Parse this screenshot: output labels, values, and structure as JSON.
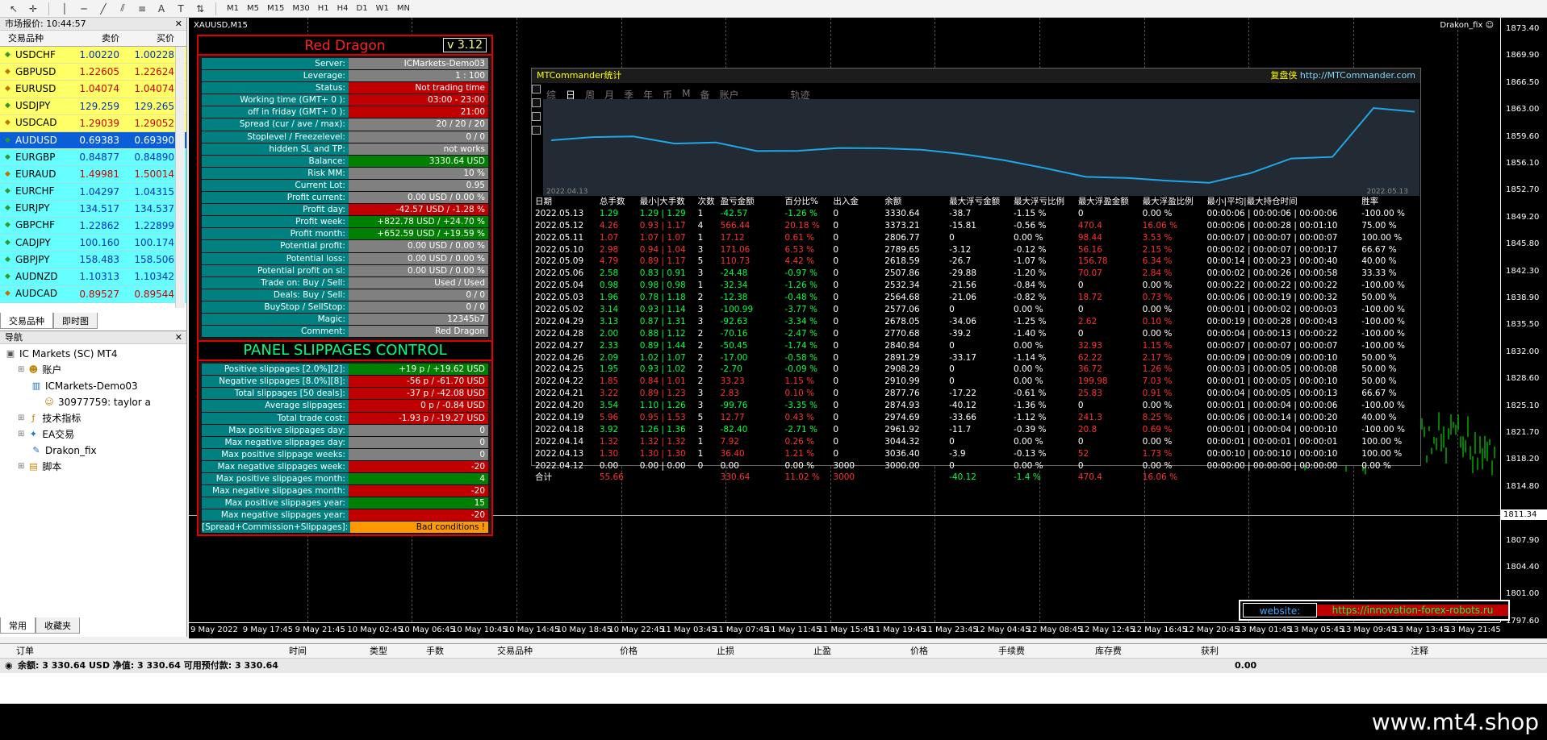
{
  "toolbar": {
    "timeframes": [
      "M1",
      "M5",
      "M15",
      "M30",
      "H1",
      "H4",
      "D1",
      "W1",
      "MN"
    ]
  },
  "market_watch": {
    "title": "市场报价: 10:44:57",
    "columns": [
      "交易品种",
      "卖价",
      "买价"
    ],
    "rows": [
      {
        "symbol": "USDCHF",
        "bid": "1.00220",
        "ask": "1.00228",
        "dir": "up",
        "style": "yellow"
      },
      {
        "symbol": "GBPUSD",
        "bid": "1.22605",
        "ask": "1.22624",
        "dir": "dn",
        "style": "yellow"
      },
      {
        "symbol": "EURUSD",
        "bid": "1.04074",
        "ask": "1.04074",
        "dir": "dn",
        "style": "yellow"
      },
      {
        "symbol": "USDJPY",
        "bid": "129.259",
        "ask": "129.265",
        "dir": "up",
        "style": "yellow"
      },
      {
        "symbol": "USDCAD",
        "bid": "1.29039",
        "ask": "1.29052",
        "dir": "dn",
        "style": "yellow"
      },
      {
        "symbol": "AUDUSD",
        "bid": "0.69383",
        "ask": "0.69390",
        "dir": "up",
        "style": "selected"
      },
      {
        "symbol": "EURGBP",
        "bid": "0.84877",
        "ask": "0.84890",
        "dir": "up",
        "style": "cyan"
      },
      {
        "symbol": "EURAUD",
        "bid": "1.49981",
        "ask": "1.50014",
        "dir": "dn",
        "style": "cyan"
      },
      {
        "symbol": "EURCHF",
        "bid": "1.04297",
        "ask": "1.04315",
        "dir": "up",
        "style": "cyan"
      },
      {
        "symbol": "EURJPY",
        "bid": "134.517",
        "ask": "134.537",
        "dir": "up",
        "style": "cyan"
      },
      {
        "symbol": "GBPCHF",
        "bid": "1.22862",
        "ask": "1.22899",
        "dir": "up",
        "style": "cyan"
      },
      {
        "symbol": "CADJPY",
        "bid": "100.160",
        "ask": "100.174",
        "dir": "up",
        "style": "cyan"
      },
      {
        "symbol": "GBPJPY",
        "bid": "158.483",
        "ask": "158.506",
        "dir": "up",
        "style": "cyan"
      },
      {
        "symbol": "AUDNZD",
        "bid": "1.10313",
        "ask": "1.10342",
        "dir": "up",
        "style": "cyan"
      },
      {
        "symbol": "AUDCAD",
        "bid": "0.89527",
        "ask": "0.89544",
        "dir": "dn",
        "style": "cyan"
      }
    ],
    "tabs": [
      "交易品种",
      "即时图"
    ]
  },
  "navigator": {
    "title": "导航",
    "items": [
      {
        "label": "IC Markets (SC) MT4",
        "level": 0,
        "icon": "terminal-icon"
      },
      {
        "label": "账户",
        "level": 1,
        "icon": "accounts-icon"
      },
      {
        "label": "ICMarkets-Demo03",
        "level": 2,
        "icon": "server-icon"
      },
      {
        "label": "30977759: taylor a",
        "level": 3,
        "icon": "user-icon"
      },
      {
        "label": "技术指标",
        "level": 1,
        "icon": "indicators-icon"
      },
      {
        "label": "EA交易",
        "level": 1,
        "icon": "expert-icon"
      },
      {
        "label": "Drakon_fix",
        "level": 2,
        "icon": "ea-icon"
      },
      {
        "label": "脚本",
        "level": 1,
        "icon": "scripts-icon"
      }
    ],
    "tabs": [
      "常用",
      "收藏夹"
    ]
  },
  "chart": {
    "title": "XAUUSD,M15",
    "ea_label": "Drakon_fix",
    "price_ticks": [
      "1873.40",
      "1869.90",
      "1866.50",
      "1863.00",
      "1859.60",
      "1856.10",
      "1852.70",
      "1849.20",
      "1845.80",
      "1842.30",
      "1838.90",
      "1835.50",
      "1832.00",
      "1828.60",
      "1825.10",
      "1821.70",
      "1818.20",
      "1814.80",
      "1811.34",
      "1807.90",
      "1804.40",
      "1801.00",
      "1797.60"
    ],
    "time_ticks": [
      "9 May 2022",
      "9 May 17:45",
      "9 May 21:45",
      "10 May 02:45",
      "10 May 06:45",
      "10 May 10:45",
      "10 May 14:45",
      "10 May 18:45",
      "10 May 22:45",
      "11 May 03:45",
      "11 May 07:45",
      "11 May 11:45",
      "11 May 15:45",
      "11 May 19:45",
      "11 May 23:45",
      "12 May 04:45",
      "12 May 08:45",
      "12 May 12:45",
      "12 May 16:45",
      "12 May 20:45",
      "13 May 01:45",
      "13 May 05:45",
      "13 May 09:45",
      "13 May 13:45",
      "13 May 21:45"
    ]
  },
  "red_dragon": {
    "title": "Red Dragon",
    "version": "v 3.12",
    "rows": [
      {
        "label": "Server:",
        "value": "ICMarkets-Demo03",
        "c": "g"
      },
      {
        "label": "Leverage:",
        "value": "1 : 100",
        "c": "g"
      },
      {
        "label": "Status:",
        "value": "Not trading time",
        "c": "r"
      },
      {
        "label": "Working time (GMT+ 0 ):",
        "value": "03:00 - 23:00",
        "c": "r"
      },
      {
        "label": "off in friday (GMT+ 0 ):",
        "value": "21:00",
        "c": "r"
      },
      {
        "label": "Spread (cur / ave / max):",
        "value": "20 / 20 / 20",
        "c": "g"
      },
      {
        "label": "Stoplevel  /  Freezelevel:",
        "value": "0  /  0",
        "c": "g"
      },
      {
        "label": "hidden SL and TP:",
        "value": "not works",
        "c": "g"
      },
      {
        "label": "Balance:",
        "value": "3330.64 USD",
        "c": "gr"
      },
      {
        "label": "Risk MM:",
        "value": "10 %",
        "c": "g"
      },
      {
        "label": "Current Lot:",
        "value": "0.95",
        "c": "g"
      },
      {
        "label": "Profit current:",
        "value": "0.00 USD / 0.00 %",
        "c": "g"
      },
      {
        "label": "Profit day:",
        "value": "-42.57 USD / -1.28 %",
        "c": "r"
      },
      {
        "label": "Profit week:",
        "value": "+822.78 USD / +24.70 %",
        "c": "gr"
      },
      {
        "label": "Profit month:",
        "value": "+652.59 USD / +19.59 %",
        "c": "gr"
      },
      {
        "label": "Potential profit:",
        "value": "0.00 USD / 0.00 %",
        "c": "g"
      },
      {
        "label": "Potential loss:",
        "value": "0.00 USD / 0.00 %",
        "c": "g"
      },
      {
        "label": "Potential profit on sl:",
        "value": "0.00 USD / 0.00 %",
        "c": "g"
      },
      {
        "label": "Trade on: Buy  /  Sell:",
        "value": "Used  /  Used",
        "c": "g"
      },
      {
        "label": "Deals: Buy / Sell:",
        "value": "0  /  0",
        "c": "g"
      },
      {
        "label": "BuyStop / SellStop:",
        "value": "0  /  0",
        "c": "g"
      },
      {
        "label": "Magic:",
        "value": "12345b7",
        "c": "g"
      },
      {
        "label": "Comment:",
        "value": "Red Dragon",
        "c": "g"
      }
    ],
    "slippage_title": "PANEL SLIPPAGES CONTROL",
    "slippage_rows": [
      {
        "label": "Positive slippages [2.0%][2]:",
        "value": "+19 p / +19.62 USD",
        "c": "gr"
      },
      {
        "label": "Negative slippages [8.0%][8]:",
        "value": "-56 p / -61.70 USD",
        "c": "r"
      },
      {
        "label": "Total slippages [50 deals]:",
        "value": "-37 p / -42.08 USD",
        "c": "r"
      },
      {
        "label": "Average slippages:",
        "value": "0 p / -0.84 USD",
        "c": "r"
      },
      {
        "label": "Total trade cost:",
        "value": "-1.93 p / -19.27 USD",
        "c": "r"
      },
      {
        "label": "Max positive slippages day:",
        "value": "0",
        "c": "g"
      },
      {
        "label": "Max negative slippages day:",
        "value": "0",
        "c": "g"
      },
      {
        "label": "Max positive slippage weeks:",
        "value": "0",
        "c": "g"
      },
      {
        "label": "Max negative slippages week:",
        "value": "-20",
        "c": "r"
      },
      {
        "label": "Max positive slippages month:",
        "value": "4",
        "c": "gr"
      },
      {
        "label": "Max negative slippages month:",
        "value": "-20",
        "c": "r"
      },
      {
        "label": "Max positive slippages year:",
        "value": "15",
        "c": "gr"
      },
      {
        "label": "Max negative slippages year:",
        "value": "-20",
        "c": "r"
      },
      {
        "label": "[Spread+Commission+Slippages]:",
        "value": "Bad conditions !",
        "c": "or"
      }
    ]
  },
  "mtc": {
    "title": "MTCommander统计",
    "link_prefix": "复盘侠",
    "link": "http://MTCommander.com",
    "tabs": [
      "综",
      "日",
      "周",
      "月",
      "季",
      "年",
      "币",
      "M",
      "备",
      "账户",
      "轨迹"
    ],
    "active_tab": "日",
    "date_start": "2022.04.13",
    "date_end": "2022.05.13",
    "headers": [
      "日期",
      "总手数",
      "最小|大手数",
      "次数",
      "盈亏金额",
      "百分比%",
      "出入金",
      "余额",
      "最大浮亏金额",
      "最大浮亏比例",
      "最大浮盈金额",
      "最大浮盈比例",
      "最小|平均|最大持仓时间",
      "胜率"
    ],
    "rows": [
      [
        "2022.05.13",
        "1.29",
        "1.29 | 1.29",
        "1",
        "-42.57",
        "-1.26 %",
        "0",
        "3330.64",
        "-38.7",
        "-1.15 %",
        "0",
        "0.00 %",
        "00:00:06 | 00:00:06 | 00:00:06",
        "-100.00 %",
        "g"
      ],
      [
        "2022.05.12",
        "4.26",
        "0.93 | 1.17",
        "4",
        "566.44",
        "20.18 %",
        "0",
        "3373.21",
        "-15.81",
        "-0.56 %",
        "470.4",
        "16.06 %",
        "00:00:06 | 00:00:28 | 00:01:10",
        "75.00 %",
        "r"
      ],
      [
        "2022.05.11",
        "1.07",
        "1.07 | 1.07",
        "1",
        "17.12",
        "0.61 %",
        "0",
        "2806.77",
        "0",
        "0.00 %",
        "98.44",
        "3.53 %",
        "00:00:07 | 00:00:07 | 00:00:07",
        "100.00 %",
        "r"
      ],
      [
        "2022.05.10",
        "2.98",
        "0.94 | 1.04",
        "3",
        "171.06",
        "6.53 %",
        "0",
        "2789.65",
        "-3.12",
        "-0.12 %",
        "56.16",
        "2.15 %",
        "00:00:02 | 00:00:07 | 00:00:17",
        "66.67 %",
        "r"
      ],
      [
        "2022.05.09",
        "4.79",
        "0.89 | 1.17",
        "5",
        "110.73",
        "4.42 %",
        "0",
        "2618.59",
        "-26.7",
        "-1.07 %",
        "156.78",
        "6.34 %",
        "00:00:14 | 00:00:23 | 00:00:40",
        "40.00 %",
        "r"
      ],
      [
        "2022.05.06",
        "2.58",
        "0.83 | 0.91",
        "3",
        "-24.48",
        "-0.97 %",
        "0",
        "2507.86",
        "-29.88",
        "-1.20 %",
        "70.07",
        "2.84 %",
        "00:00:02 | 00:00:26 | 00:00:58",
        "33.33 %",
        "g"
      ],
      [
        "2022.05.04",
        "0.98",
        "0.98 | 0.98",
        "1",
        "-32.34",
        "-1.26 %",
        "0",
        "2532.34",
        "-21.56",
        "-0.84 %",
        "0",
        "0.00 %",
        "00:00:22 | 00:00:22 | 00:00:22",
        "-100.00 %",
        "g"
      ],
      [
        "2022.05.03",
        "1.96",
        "0.78 | 1.18",
        "2",
        "-12.38",
        "-0.48 %",
        "0",
        "2564.68",
        "-21.06",
        "-0.82 %",
        "18.72",
        "0.73 %",
        "00:00:06 | 00:00:19 | 00:00:32",
        "50.00 %",
        "g"
      ],
      [
        "2022.05.02",
        "3.14",
        "0.93 | 1.14",
        "3",
        "-100.99",
        "-3.77 %",
        "0",
        "2577.06",
        "0",
        "0.00 %",
        "0",
        "0.00 %",
        "00:00:01 | 00:00:02 | 00:00:03",
        "-100.00 %",
        "g"
      ],
      [
        "2022.04.29",
        "3.13",
        "0.87 | 1.31",
        "3",
        "-92.63",
        "-3.34 %",
        "0",
        "2678.05",
        "-34.06",
        "-1.25 %",
        "2.62",
        "0.10 %",
        "00:00:19 | 00:00:28 | 00:00:43",
        "-100.00 %",
        "g"
      ],
      [
        "2022.04.28",
        "2.00",
        "0.88 | 1.12",
        "2",
        "-70.16",
        "-2.47 %",
        "0",
        "2770.68",
        "-39.2",
        "-1.40 %",
        "0",
        "0.00 %",
        "00:00:04 | 00:00:13 | 00:00:22",
        "-100.00 %",
        "g"
      ],
      [
        "2022.04.27",
        "2.33",
        "0.89 | 1.44",
        "2",
        "-50.45",
        "-1.74 %",
        "0",
        "2840.84",
        "0",
        "0.00 %",
        "32.93",
        "1.15 %",
        "00:00:07 | 00:00:07 | 00:00:07",
        "-100.00 %",
        "g"
      ],
      [
        "2022.04.26",
        "2.09",
        "1.02 | 1.07",
        "2",
        "-17.00",
        "-0.58 %",
        "0",
        "2891.29",
        "-33.17",
        "-1.14 %",
        "62.22",
        "2.17 %",
        "00:00:09 | 00:00:09 | 00:00:10",
        "50.00 %",
        "g"
      ],
      [
        "2022.04.25",
        "1.95",
        "0.93 | 1.02",
        "2",
        "-2.70",
        "-0.09 %",
        "0",
        "2908.29",
        "0",
        "0.00 %",
        "36.72",
        "1.26 %",
        "00:00:03 | 00:00:05 | 00:00:08",
        "50.00 %",
        "g"
      ],
      [
        "2022.04.22",
        "1.85",
        "0.84 | 1.01",
        "2",
        "33.23",
        "1.15 %",
        "0",
        "2910.99",
        "0",
        "0.00 %",
        "199.98",
        "7.03 %",
        "00:00:01 | 00:00:05 | 00:00:10",
        "50.00 %",
        "r"
      ],
      [
        "2022.04.21",
        "3.22",
        "0.89 | 1.23",
        "3",
        "2.83",
        "0.10 %",
        "0",
        "2877.76",
        "-17.22",
        "-0.61 %",
        "25.83",
        "0.91 %",
        "00:00:04 | 00:00:05 | 00:00:13",
        "66.67 %",
        "r"
      ],
      [
        "2022.04.20",
        "3.54",
        "1.10 | 1.26",
        "3",
        "-99.76",
        "-3.35 %",
        "0",
        "2874.93",
        "-40.12",
        "-1.36 %",
        "0",
        "0.00 %",
        "00:00:01 | 00:00:04 | 00:00:06",
        "-100.00 %",
        "g"
      ],
      [
        "2022.04.19",
        "5.96",
        "0.95 | 1.53",
        "5",
        "12.77",
        "0.43 %",
        "0",
        "2974.69",
        "-33.66",
        "-1.12 %",
        "241.3",
        "8.25 %",
        "00:00:06 | 00:00:14 | 00:00:20",
        "40.00 %",
        "r"
      ],
      [
        "2022.04.18",
        "3.92",
        "1.26 | 1.36",
        "3",
        "-82.40",
        "-2.71 %",
        "0",
        "2961.92",
        "-11.7",
        "-0.39 %",
        "20.8",
        "0.69 %",
        "00:00:01 | 00:00:04 | 00:00:10",
        "-100.00 %",
        "g"
      ],
      [
        "2022.04.14",
        "1.32",
        "1.32 | 1.32",
        "1",
        "7.92",
        "0.26 %",
        "0",
        "3044.32",
        "0",
        "0.00 %",
        "0",
        "0.00 %",
        "00:00:01 | 00:00:01 | 00:00:01",
        "100.00 %",
        "r"
      ],
      [
        "2022.04.13",
        "1.30",
        "1.30 | 1.30",
        "1",
        "36.40",
        "1.21 %",
        "0",
        "3036.40",
        "-3.9",
        "-0.13 %",
        "52",
        "1.73 %",
        "00:00:10 | 00:00:10 | 00:00:10",
        "100.00 %",
        "r"
      ],
      [
        "2022.04.12",
        "0.00",
        "0.00 | 0.00",
        "0",
        "0.00",
        "0.00 %",
        "3000",
        "3000.00",
        "0",
        "0.00 %",
        "0",
        "0.00 %",
        "00:00:00 | 00:00:00 | 00:00:00",
        "0.00 %",
        "w"
      ]
    ],
    "total": [
      "合计",
      "55.66",
      "",
      "",
      "330.64",
      "11.02 %",
      "3000",
      "",
      "-40.12",
      "-1.4 %",
      "470.4",
      "16.06 %",
      "",
      ""
    ],
    "equity_curve": [
      3000,
      3036.4,
      3044.32,
      2961.92,
      2974.69,
      2874.93,
      2877.76,
      2910.99,
      2908.29,
      2891.29,
      2840.84,
      2770.68,
      2678.05,
      2577.06,
      2564.68,
      2532.34,
      2507.86,
      2618.59,
      2789.65,
      2806.77,
      3373.21,
      3330.64
    ]
  },
  "website": {
    "label": "website:",
    "url": "https://innovation-forex-robots.ru"
  },
  "terminal": {
    "headers": [
      "订单",
      "时间",
      "类型",
      "手数",
      "交易品种",
      "价格",
      "止损",
      "止盈",
      "价格",
      "手续费",
      "库存费",
      "获利",
      "注释"
    ],
    "balance_text": "余额: 3 330.64 USD  净值: 3 330.64  可用预付款: 3 330.64",
    "profit": "0.00"
  },
  "footer": {
    "watermark": "www.mt4.shop"
  },
  "colors": {
    "accent_red": "#e00000",
    "teal": "#008080",
    "green": "#008000",
    "curve": "#1ea8e8"
  }
}
